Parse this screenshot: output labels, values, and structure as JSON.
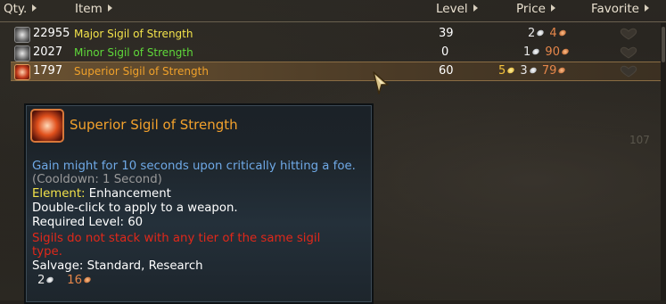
{
  "headers": {
    "qty": "Qty.",
    "item": "Item",
    "level": "Level",
    "price": "Price",
    "favorite": "Favorite"
  },
  "rows": [
    {
      "qty": "22955",
      "name": "Major Sigil of Strength",
      "name_color": "#f2e24a",
      "level": "39",
      "price": {
        "gold": "",
        "silver": "2",
        "copper": "4"
      },
      "icon": "sigil-icon"
    },
    {
      "qty": "2027",
      "name": "Minor Sigil of Strength",
      "name_color": "#5fd83a",
      "level": "0",
      "price": {
        "gold": "",
        "silver": "1",
        "copper": "90"
      },
      "icon": "sigil-icon"
    },
    {
      "qty": "1797",
      "name": "Superior Sigil of Strength",
      "name_color": "#f0a12a",
      "level": "60",
      "price": {
        "gold": "5",
        "silver": "3",
        "copper": "79"
      },
      "icon": "superior-sigil-icon",
      "selected": true
    }
  ],
  "tooltip": {
    "title": "Superior Sigil of Strength",
    "effect": "Gain might for 10 seconds upon critically hitting a foe.",
    "cooldown": "(Cooldown: 1 Second)",
    "element_label": "Element:",
    "element_value": "Enhancement",
    "usage": "Double-click to apply to a weapon.",
    "required_level": "Required Level: 60",
    "warning_line1": "Sigils do not stack with any tier of the same sigil",
    "warning_line2": "type.",
    "salvage": "Salvage: Standard, Research",
    "vendor_silver": "2",
    "vendor_copper": "16"
  },
  "faded_text": "107",
  "colors": {
    "gold": "#f3c13a",
    "silver": "#e6e6e6",
    "copper": "#e5864a",
    "effect_blue": "#6fa9e6",
    "warning_red": "#e0281a",
    "element_yellow": "#f2e24a"
  }
}
